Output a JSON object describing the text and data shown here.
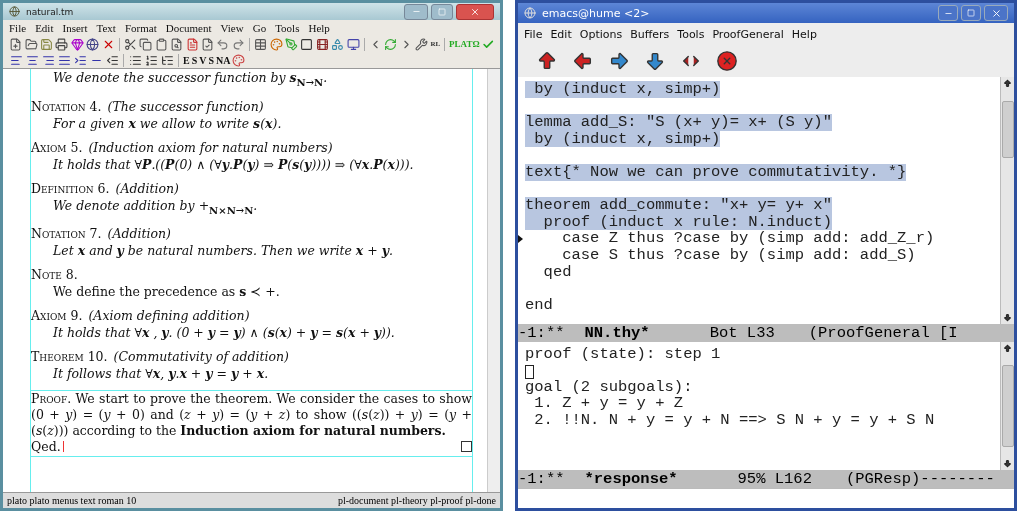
{
  "texmacs": {
    "title": "natural.tm",
    "menu": [
      "File",
      "Edit",
      "Insert",
      "Text",
      "Format",
      "Document",
      "View",
      "Go",
      "Tools",
      "Help"
    ],
    "toolbar_label": "RL",
    "plato_label": "PLATΩ",
    "format_labels": [
      "E",
      "S",
      "V",
      "S",
      "NA"
    ],
    "top_line": "We denote the successor function by **s**$_{N→N}$.",
    "blocks": [
      {
        "label": "Notation 4.",
        "title": "(The successor function)",
        "body": "For a given **x** we allow to write **s**(**x**).",
        "upright": false
      },
      {
        "label": "Axiom 5.",
        "title": "(Induction axiom for natural numbers)",
        "body": "It holds that ∀**P**.((**P**(0) ∧ (∀**y**.**P**(**y**) ⇒ **P**(**s**(**y**)))) ⇒ (∀**x**.**P**(**x**))).",
        "upright": false
      },
      {
        "label": "Definition 6.",
        "title": "(Addition)",
        "body": "We denote addition by +$_{N×N→N}$.",
        "upright": false
      },
      {
        "label": "Notation 7.",
        "title": "(Addition)",
        "body": "Let **x** and **y** be natural numbers. Then we write **x** + **y**.",
        "upright": false
      },
      {
        "label": "Note 8.",
        "body": "We define the precedence as **s** ≺ +.",
        "upright": true
      },
      {
        "label": "Axiom 9.",
        "title": "(Axiom defining addition)",
        "body": "It holds that ∀**x** , **y**. (0 + **y** = **y**) ∧ (**s**(**x**) + **y** = **s**(**x** + **y**)).",
        "upright": false
      },
      {
        "label": "Theorem 10.",
        "title": "(Commutativity of addition)",
        "body": "It follows that ∀**x**, **y**.**x** + **y** = **y** + **x**.",
        "upright": false
      }
    ],
    "proof": {
      "label": "Proof.",
      "text": "We start to prove the theorem. We consider the cases  to show (0 + *y*) = (*y* + 0) and (*z* + *y*) = (*y* + *z*) to show ((*s*(*z*)) + *y*) = (*y* + (*s*(*z*)))  according to the **Induction axiom for natural numbers.**",
      "end": "Qed."
    },
    "status_left": "plato plato menus text roman 10",
    "status_right": "pl-document pl-theory pl-proof pl-done"
  },
  "emacs": {
    "title": "emacs@hume <2>",
    "menu": [
      "File",
      "Edit",
      "Options",
      "Buffers",
      "Tools",
      "ProofGeneral",
      "Help"
    ],
    "code_lines": [
      {
        "text": " by (induct x, simp+)",
        "highlighted": true,
        "space_before": false,
        "pointer": false
      },
      {
        "text": "lemma add_S: \"S (x+ y)= x+ (S y)\"",
        "highlighted": true,
        "space_before": true,
        "pointer": false
      },
      {
        "text": " by (induct x, simp+)",
        "highlighted": true,
        "space_before": false,
        "pointer": false
      },
      {
        "text": "text{* Now we can prove commutativity. *}",
        "highlighted": true,
        "space_before": true,
        "pointer": false
      },
      {
        "text": "theorem add_commute: \"x+ y= y+ x\"",
        "highlighted": true,
        "space_before": true,
        "pointer": false
      },
      {
        "text": "  proof (induct x rule: N.induct)",
        "highlighted": true,
        "space_before": false,
        "pointer": false
      },
      {
        "text": "    case Z thus ?case by (simp add: add_Z_r)",
        "highlighted": false,
        "space_before": false,
        "pointer": true
      },
      {
        "text": "    case S thus ?case by (simp add: add_S)",
        "highlighted": false,
        "space_before": false,
        "pointer": false
      },
      {
        "text": "  qed",
        "highlighted": false,
        "space_before": false,
        "pointer": false
      },
      {
        "text": "end",
        "highlighted": false,
        "space_before": true,
        "pointer": false
      }
    ],
    "mode_line": {
      "flags": "-1:**",
      "buffer": "NN.thy*",
      "position": "Bot L33",
      "mode": "(ProofGeneral [I"
    },
    "response_lines": [
      {
        "text": "proof (state): step 1"
      },
      {
        "cursor": true
      },
      {
        "text": "goal (2 subgoals):"
      },
      {
        "text": " 1. Z + y = y + Z"
      },
      {
        "text": " 2. !!N. N + y = y + N ==> S N + y = y + S N"
      }
    ],
    "response_mode_line": {
      "flags": "-1:**",
      "buffer": "*response*",
      "position": "95% L162",
      "mode": "(PGResp)--------"
    }
  }
}
